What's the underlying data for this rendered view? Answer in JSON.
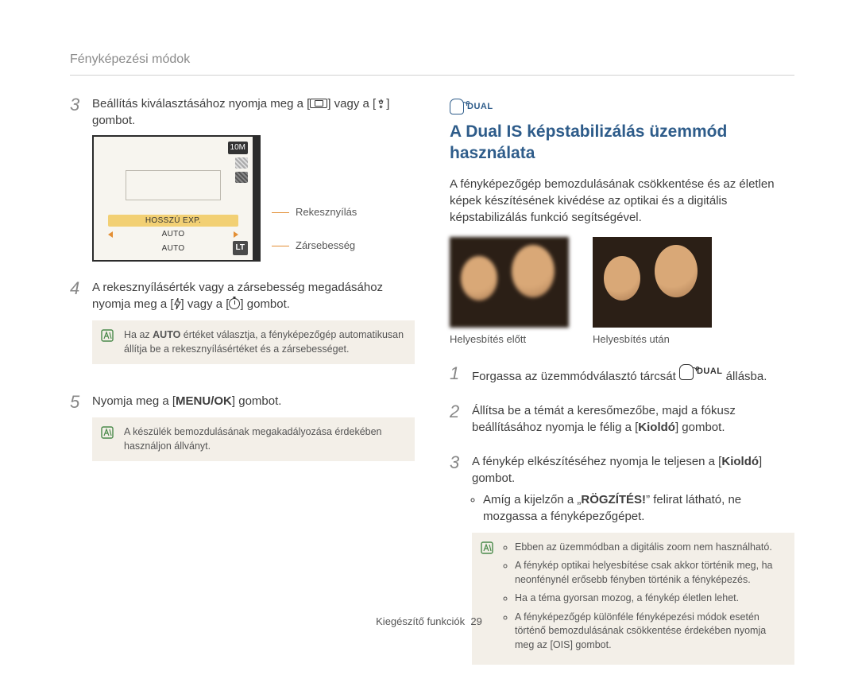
{
  "breadcrumb": "Fényképezési módok",
  "left": {
    "step3": {
      "text_a": "Beállítás kiválasztásához nyomja meg a [",
      "text_b": "] vagy a [",
      "text_c": "] gombot."
    },
    "lcd": {
      "tenM": "10M",
      "hosszu": "HOSSZÚ EXP.",
      "auto1": "AUTO",
      "auto2": "AUTO",
      "lt": "LT"
    },
    "leaders": {
      "aperture": "Rekesznyílás",
      "shutter": "Zársebesség"
    },
    "step4": {
      "text_a": "A rekesznyílásérték vagy a zársebesség megadásához nyomja meg a [",
      "text_b": "] vagy a [",
      "text_c": "] gombot."
    },
    "note1": {
      "pre": "Ha az ",
      "auto": "AUTO",
      "post": " értéket választja, a fényképezőgép automatikusan állítja be a rekesznyílásértéket és a zársebességet."
    },
    "step5": {
      "text_a": "Nyomja meg a [",
      "menu": "MENU/OK",
      "text_b": "] gombot."
    },
    "note2": "A készülék bemozdulásának megakadályozása érdekében használjon állványt."
  },
  "right": {
    "heading_dual": "DUAL",
    "heading_rest": "A Dual IS képstabilizálás üzemmód használata",
    "intro": "A fényképezőgép bemozdulásának csökkentése és az életlen képek készítésének kivédése az optikai és a digitális képstabilizálás funkció segítségével.",
    "cmp_before": "Helyesbítés előtt",
    "cmp_after": "Helyesbítés után",
    "step1": {
      "a": "Forgassa az üzemmódválasztó tárcsát ",
      "b": " állásba."
    },
    "step2": {
      "a": "Állítsa be a témát a keresőmezőbe, majd a fókusz beállításához nyomja le félig a [",
      "kioldo": "Kioldó",
      "b": "] gombot."
    },
    "step3": {
      "a": "A fénykép elkészítéséhez nyomja le teljesen a [",
      "kioldo": "Kioldó",
      "b": "] gombot."
    },
    "sub": {
      "a": "Amíg a kijelzőn a „",
      "rog": "RÖGZÍTÉS!",
      "b": "” felirat látható, ne mozgassa a fényképezőgépet."
    },
    "notes": [
      "Ebben az üzemmódban a digitális zoom nem használható.",
      "A fénykép optikai helyesbítése csak akkor történik meg, ha neonfénynél erősebb fényben történik a fényképezés.",
      "Ha a téma gyorsan mozog, a fénykép életlen lehet.",
      "A fényképezőgép különféle fényképezési módok esetén történő bemozdulásának csökkentése érdekében nyomja meg az [OIS] gombot."
    ],
    "note_ois_bold": "OIS"
  },
  "footer": {
    "label": "Kiegészítő funkciók",
    "page": "29"
  }
}
